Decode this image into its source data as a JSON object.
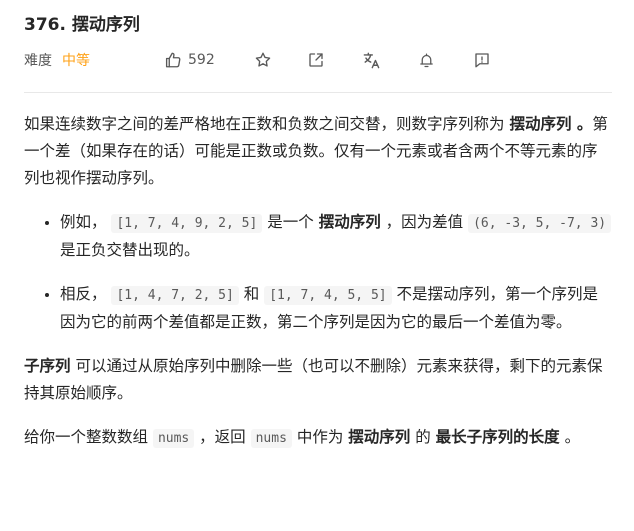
{
  "problem": {
    "title": "376. 摆动序列",
    "difficulty_label": "难度",
    "difficulty": "中等",
    "likes": "592"
  },
  "icons": {
    "like": "thumbs-up-icon",
    "star": "star-icon",
    "share": "share-icon",
    "translate": "translate-icon",
    "bell": "bell-icon",
    "feedback": "feedback-icon"
  },
  "colors": {
    "difficulty": "#ffa116",
    "text": "#262626",
    "code_bg": "#f5f5f5"
  },
  "description": {
    "p1_a": "如果连续数字之间的差严格地在正数和负数之间交替，则数字序列称为 ",
    "p1_bold": "摆动序列 。",
    "p1_b": "第一个差（如果存在的话）可能是正数或负数。仅有一个元素或者含两个不等元素的序列也视作摆动序列。",
    "b1_a": "例如， ",
    "b1_code1": "[1, 7, 4, 9, 2, 5]",
    "b1_b": " 是一个 ",
    "b1_bold": "摆动序列",
    "b1_c": " ，因为差值 ",
    "b1_code2": "(6, -3, 5, -7, 3)",
    "b1_d": " 是正负交替出现的。",
    "b2_a": "相反， ",
    "b2_code1": "[1, 4, 7, 2, 5]",
    "b2_b": " 和 ",
    "b2_code2": "[1, 7, 4, 5, 5]",
    "b2_c": " 不是摆动序列，第一个序列是因为它的前两个差值都是正数，第二个序列是因为它的最后一个差值为零。",
    "p2_bold": "子序列",
    "p2_a": " 可以通过从原始序列中删除一些（也可以不删除）元素来获得，剩下的元素保持其原始顺序。",
    "p3_a": "给你一个整数数组 ",
    "p3_code": "nums",
    "p3_b": " ，返回 ",
    "p3_code2": "nums",
    "p3_c": " 中作为 ",
    "p3_bold1": "摆动序列",
    "p3_d": " 的 ",
    "p3_bold2": "最长子序列的长度",
    "p3_e": " 。"
  }
}
